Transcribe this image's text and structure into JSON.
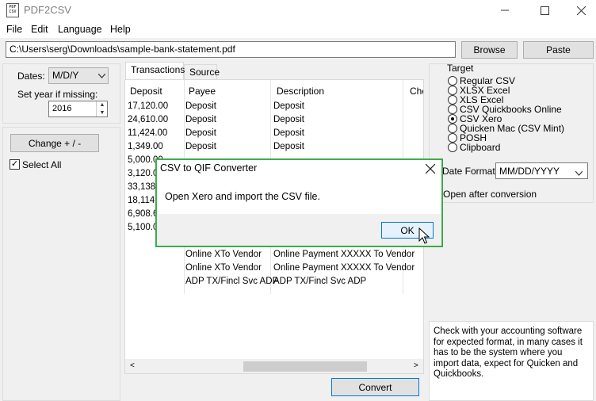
{
  "window": {
    "app_icon_text": "PDF\nCSV",
    "title": "PDF2CSV"
  },
  "menu": {
    "items": [
      "File",
      "Edit",
      "Language",
      "Help"
    ]
  },
  "path": {
    "value": "C:\\Users\\serg\\Downloads\\sample-bank-statement.pdf"
  },
  "buttons": {
    "browse": "Browse",
    "paste": "Paste",
    "change": "Change + / -",
    "convert": "Convert"
  },
  "left": {
    "dates_label": "Dates:",
    "dates_value": "M/D/Y",
    "year_label": "Set year if missing:",
    "year_value": "2016",
    "select_all_label": "Select All",
    "select_all_checked": true
  },
  "tabs": [
    {
      "label": "Transactions",
      "active": true
    },
    {
      "label": "Source",
      "active": false
    }
  ],
  "grid": {
    "columns": [
      "Deposit",
      "Payee",
      "Description",
      "Che"
    ],
    "rows": [
      [
        "17,120.00",
        "Deposit",
        "Deposit"
      ],
      [
        "24,610.00",
        "Deposit",
        "Deposit"
      ],
      [
        "11,424.00",
        "Deposit",
        "Deposit"
      ],
      [
        "1,349.00",
        "Deposit",
        "Deposit"
      ],
      [
        "5,000.00",
        "",
        ""
      ],
      [
        "3,120.0",
        "",
        ""
      ],
      [
        "33,138.",
        "",
        ""
      ],
      [
        "18,114.",
        "",
        ""
      ],
      [
        "6,908.6",
        "",
        ""
      ],
      [
        "5,100.0",
        "",
        ""
      ],
      [
        "",
        "",
        ""
      ],
      [
        "",
        "Online XTo Vendor",
        "Online Payment XXXXX To Vendor"
      ],
      [
        "",
        "Online XTo Vendor",
        "Online Payment XXXXX To Vendor"
      ],
      [
        "",
        "ADP TX/Fincl Svc ADP",
        "ADP TX/Fincl Svc ADP"
      ]
    ]
  },
  "target": {
    "label": "Target",
    "options": [
      "Regular CSV",
      "XLSX Excel",
      "XLS Excel",
      "CSV Quickbooks Online",
      "CSV Xero",
      "Quicken Mac (CSV Mint)",
      "POSH",
      "Clipboard"
    ],
    "selected": "CSV Xero",
    "date_format_label": "Date Format:",
    "date_format_value": "MM/DD/YYYY",
    "open_after_label": "Open after conversion",
    "hint": "Check with your accounting software for expected format, in many cases it has to be the system where you import data, expect for Quicken and Quickbooks."
  },
  "dialog": {
    "title": "CSV to QIF Converter",
    "message": "Open Xero and import the CSV file.",
    "ok_label": "OK"
  }
}
